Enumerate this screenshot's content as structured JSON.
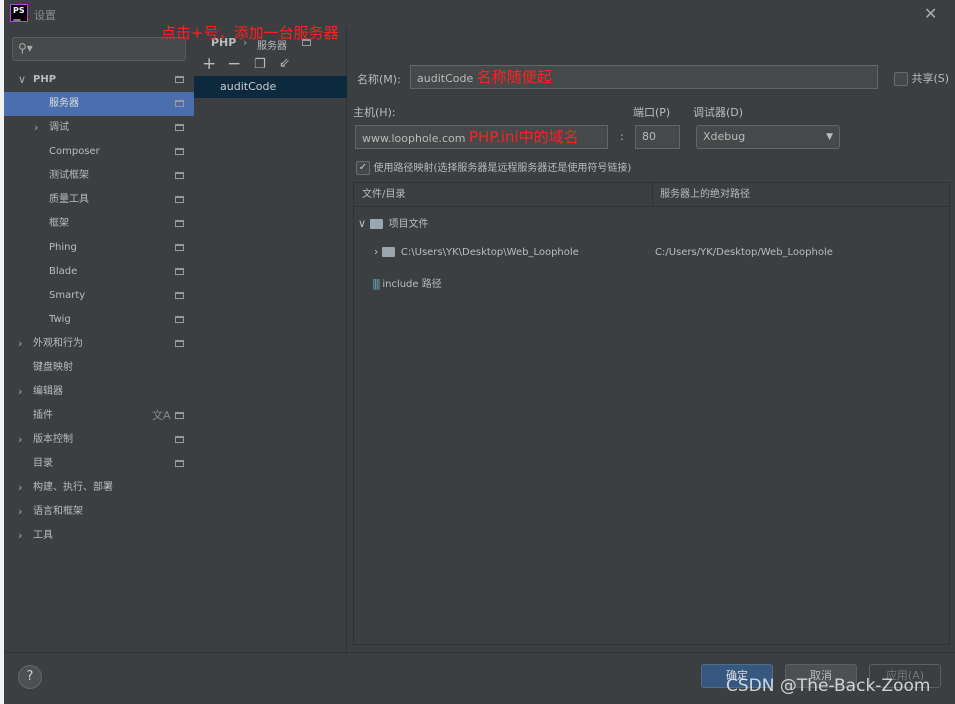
{
  "window": {
    "title": "设置",
    "logo": "PS"
  },
  "annotations": {
    "top": "点击+号，添加一台服务器",
    "name": "名称随便起",
    "host": "PHP.ini中的域名"
  },
  "sidebar": {
    "items": [
      {
        "label": "PHP",
        "arrow": "∨",
        "bold": true
      },
      {
        "label": "服务器",
        "selected": true
      },
      {
        "label": "调试",
        "arrow": "›"
      },
      {
        "label": "Composer"
      },
      {
        "label": "测试框架"
      },
      {
        "label": "质量工具"
      },
      {
        "label": "框架"
      },
      {
        "label": "Phing"
      },
      {
        "label": "Blade"
      },
      {
        "label": "Smarty"
      },
      {
        "label": "Twig"
      },
      {
        "label": "外观和行为",
        "arrow": "›",
        "top": true
      },
      {
        "label": "键盘映射",
        "top": true,
        "nopin": true
      },
      {
        "label": "编辑器",
        "arrow": "›",
        "top": true,
        "nopin": true
      },
      {
        "label": "插件",
        "top": true
      },
      {
        "label": "版本控制",
        "arrow": "›",
        "top": true
      },
      {
        "label": "目录",
        "top": true
      },
      {
        "label": "构建、执行、部署",
        "arrow": "›",
        "top": true,
        "nopin": true
      },
      {
        "label": "语言和框架",
        "arrow": "›",
        "top": true,
        "nopin": true
      },
      {
        "label": "工具",
        "arrow": "›",
        "top": true,
        "nopin": true
      }
    ]
  },
  "breadcrumb": {
    "root": "PHP",
    "sep": "›",
    "current": "服务器"
  },
  "servers": [
    "auditCode"
  ],
  "form": {
    "name_label": "名称(M):",
    "name_value": "auditCode",
    "share_label": "共享(S)",
    "host_label": "主机(H):",
    "host_value": "www.loophole.com",
    "port_label": "端口(P)",
    "port_value": "80",
    "debugger_label": "调试器(D)",
    "debugger_value": "Xdebug",
    "mapping_label": "使用路径映射(选择服务器是远程服务器还是使用符号链接)",
    "mapping_checked": true
  },
  "table": {
    "headers": [
      "文件/目录",
      "服务器上的绝对路径"
    ],
    "project_files": "项目文件",
    "row_local": "C:\\Users\\YK\\Desktop\\Web_Loophole",
    "row_remote": "C:/Users/YK/Desktop/Web_Loophole",
    "include": "include 路径"
  },
  "buttons": {
    "ok": "确定",
    "cancel": "取消",
    "apply": "应用(A)",
    "help": "?"
  },
  "watermark": "CSDN @The-Back-Zoom"
}
